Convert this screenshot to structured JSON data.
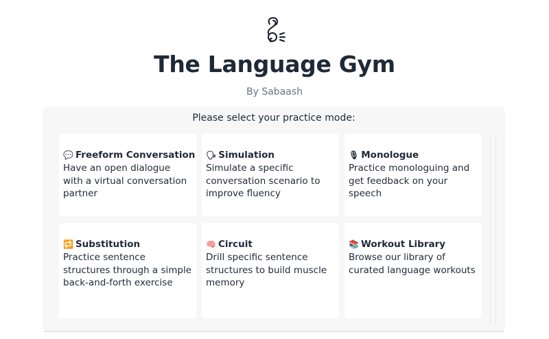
{
  "app": {
    "title": "The Language Gym",
    "byline": "By Sabaash",
    "logo_icon": "person-speaking-logo"
  },
  "panel": {
    "prompt": "Please select your practice mode:"
  },
  "modes": [
    {
      "icon": "💬",
      "icon_name": "speech-bubble-icon",
      "title": "Freeform Conversation",
      "description": "Have an open dialogue with a virtual conversation partner"
    },
    {
      "icon": "🗣",
      "icon_name": "speaking-head-icon",
      "title": "Simulation",
      "description": "Simulate a specific conversation scenario to improve fluency"
    },
    {
      "icon": "🎙",
      "icon_name": "microphone-icon",
      "title": "Monologue",
      "description": "Practice monologuing and get feedback on your speech"
    },
    {
      "icon": "🔁",
      "icon_name": "repeat-icon",
      "title": "Substitution",
      "description": "Practice sentence structures through a simple back-and-forth exercise"
    },
    {
      "icon": "🧠",
      "icon_name": "brain-icon",
      "title": "Circuit",
      "description": "Drill specific sentence structures to build muscle memory"
    },
    {
      "icon": "📚",
      "icon_name": "books-icon",
      "title": "Workout Library",
      "description": "Browse our library of curated language workouts"
    }
  ]
}
